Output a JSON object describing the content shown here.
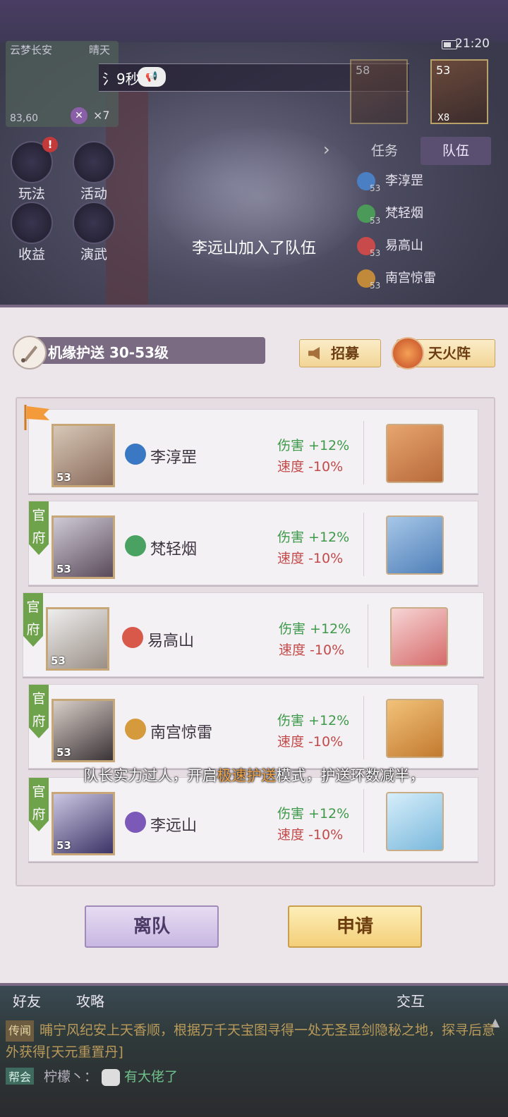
{
  "hud": {
    "time": "21:20",
    "map_name": "云梦长安",
    "weather": "晴天",
    "coords": "83,60",
    "multiplier": "×7",
    "announce": "氵9秒",
    "portrait1_level": "58",
    "portrait2_level": "53",
    "portrait2_mult": "X8",
    "badge": "!"
  },
  "side_buttons": [
    {
      "label": "玩法"
    },
    {
      "label": "活动"
    },
    {
      "label": "收益"
    },
    {
      "label": "演武"
    }
  ],
  "tabs": {
    "task": "任务",
    "team": "队伍"
  },
  "team_mini": [
    {
      "name": "李淳罡",
      "level": "53",
      "color": "#4a7fc4"
    },
    {
      "name": "梵轻烟",
      "level": "53",
      "color": "#4c9a5a"
    },
    {
      "name": "易高山",
      "level": "53",
      "color": "#c84a4a"
    },
    {
      "name": "南宫惊雷",
      "level": "53",
      "color": "#c08a3a"
    }
  ],
  "toast": "李远山加入了队伍",
  "panel": {
    "title": "机缘护送  30-53级",
    "recruit": "招募",
    "formation": "天火阵",
    "members": [
      {
        "name": "李淳罡",
        "level": "53",
        "official": "",
        "job_color": "#3a78c4",
        "dmg": "伤害 +12%",
        "spd": "速度 -10%",
        "pet_color": "#d9864f"
      },
      {
        "name": "梵轻烟",
        "level": "53",
        "official": "官府",
        "job_color": "#4aa262",
        "dmg": "伤害 +12%",
        "spd": "速度 -10%",
        "pet_color": "#7aa9d8"
      },
      {
        "name": "易高山",
        "level": "53",
        "official": "官府",
        "job_color": "#d8584a",
        "dmg": "伤害 +12%",
        "spd": "速度 -10%",
        "pet_color": "#e99a9a"
      },
      {
        "name": "南宫惊雷",
        "level": "53",
        "official": "官府",
        "job_color": "#d49a3c",
        "dmg": "伤害 +12%",
        "spd": "速度 -10%",
        "pet_color": "#e4a55b"
      },
      {
        "name": "李远山",
        "level": "53",
        "official": "官府",
        "job_color": "#7c58b8",
        "dmg": "伤害 +12%",
        "spd": "速度 -10%",
        "pet_color": "#9fd2ec"
      }
    ],
    "leave": "离队",
    "apply": "申请"
  },
  "subtitle": {
    "pre": "队长实力过人，开启",
    "hl": "极速护送",
    "post": "模式，护送环数减半，"
  },
  "bottom": {
    "friends": "好友",
    "guide": "攻略",
    "interact": "交互"
  },
  "chat": {
    "line1_tag": "传闻",
    "line1": "晡宁风纪安上天香顺，根据万千天宝图寻得一处无圣显剑隐秘之地，探寻后意外获得[天元重置丹]",
    "line2_tag": "帮会",
    "line2_user": "柠檬丶：",
    "line2_msg": "有大佬了"
  }
}
